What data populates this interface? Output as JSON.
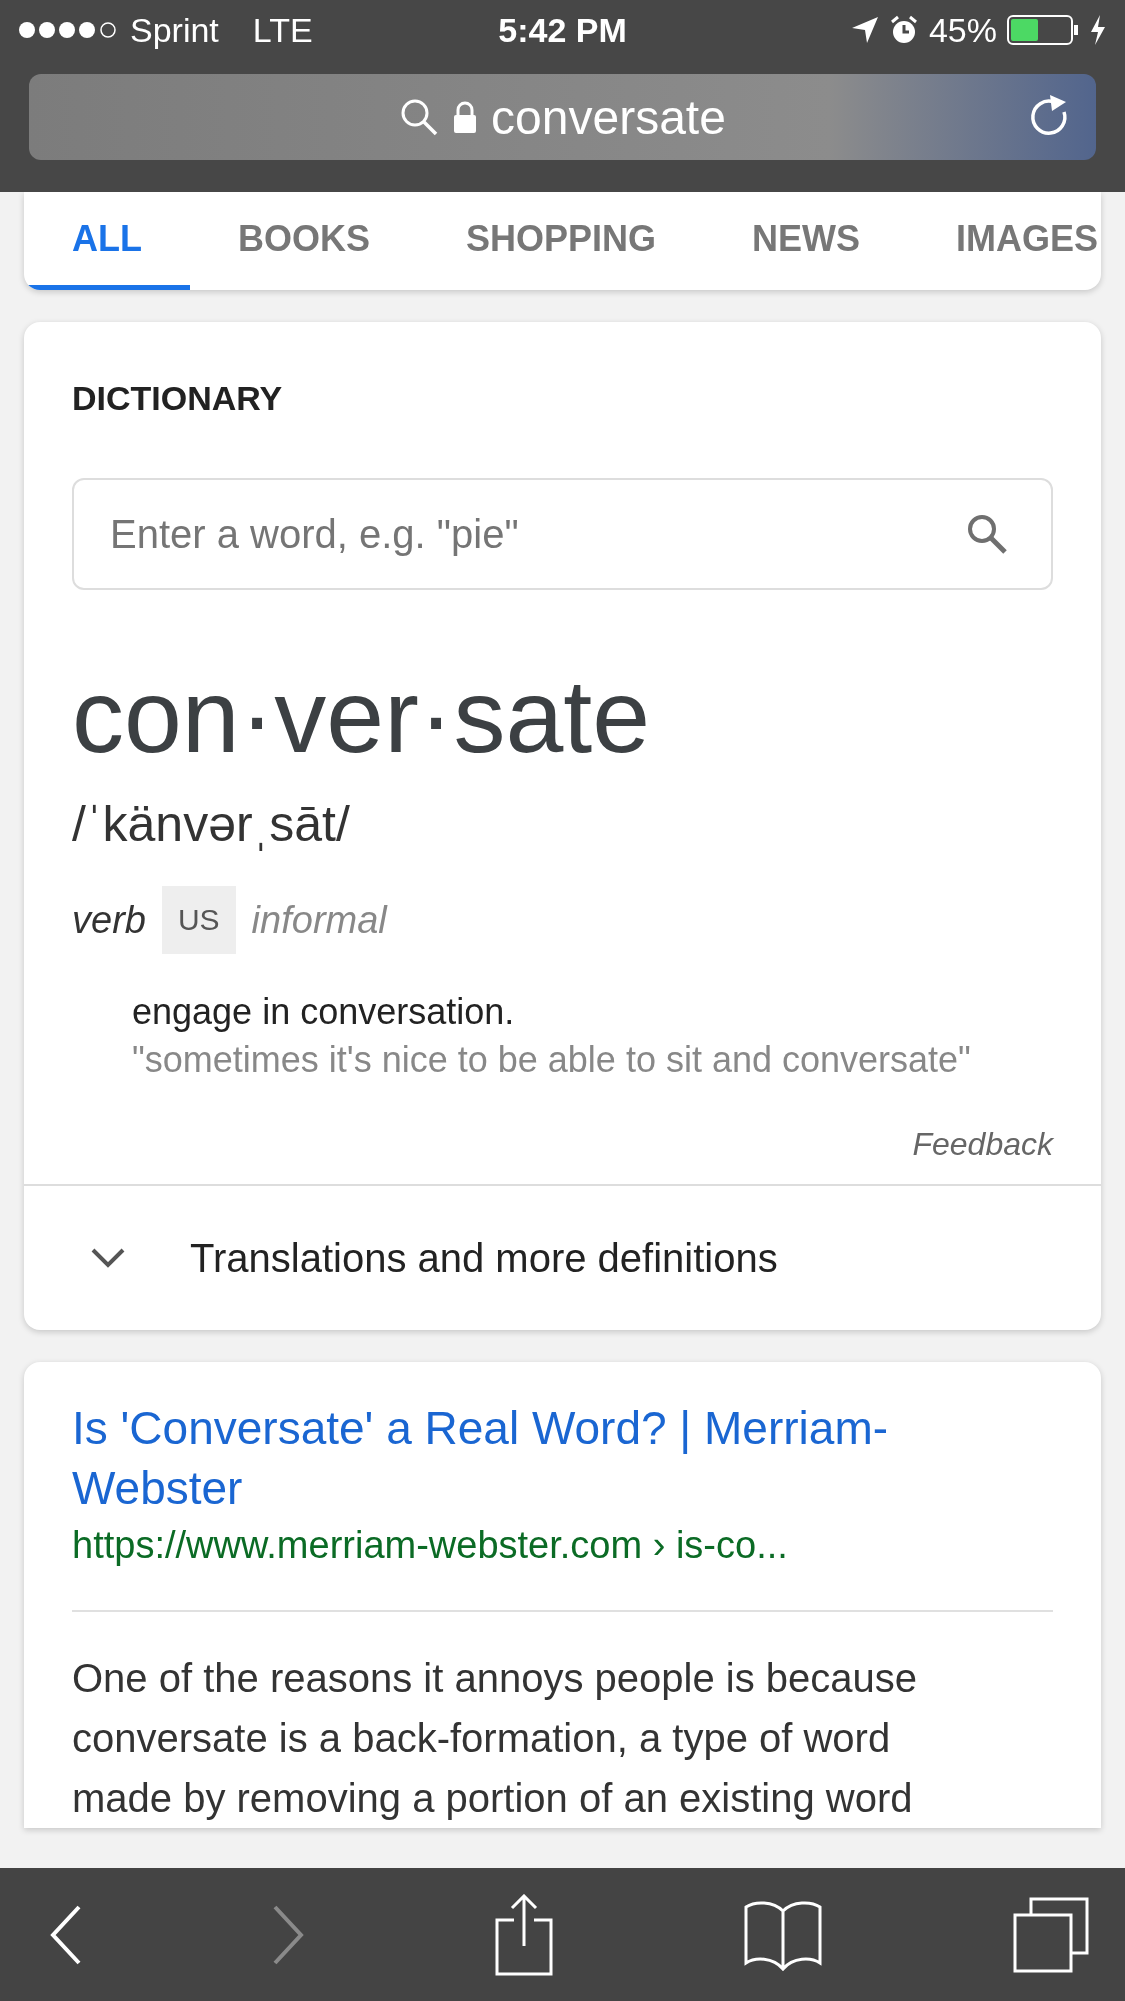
{
  "status_bar": {
    "carrier": "Sprint",
    "network": "LTE",
    "time": "5:42 PM",
    "battery": "45%"
  },
  "address_bar": {
    "text": "conversate"
  },
  "tabs": [
    {
      "label": "ALL",
      "selected": true
    },
    {
      "label": "BOOKS",
      "selected": false
    },
    {
      "label": "SHOPPING",
      "selected": false
    },
    {
      "label": "NEWS",
      "selected": false
    },
    {
      "label": "IMAGES",
      "selected": false
    }
  ],
  "dictionary": {
    "heading": "DICTIONARY",
    "search": {
      "placeholder": "Enter a word, e.g. \"pie\""
    },
    "headword": "con·ver·sate",
    "pronunciation": "/ˈkänvərˌsāt/",
    "part_of_speech": "verb",
    "labels": [
      {
        "text": "US",
        "kind": "tag"
      },
      {
        "text": "informal",
        "kind": "register"
      }
    ],
    "definition": "engage in conversation.",
    "example": "\"sometimes it's nice to be able to sit and conversate\"",
    "feedback": "Feedback",
    "more": {
      "label": "Translations and more definitions",
      "expanded": false
    }
  },
  "result": {
    "title": "Is 'Conversate' a Real Word? | Merriam-Webster",
    "url": "https://www.merriam-webster.com › is-co...",
    "snippet": "One of the reasons it annoys people is because conversate is a back-formation, a type of word made by removing a portion of an existing word"
  },
  "toolbar": {
    "back": {
      "disabled": false
    },
    "forward": {
      "disabled": true
    }
  }
}
